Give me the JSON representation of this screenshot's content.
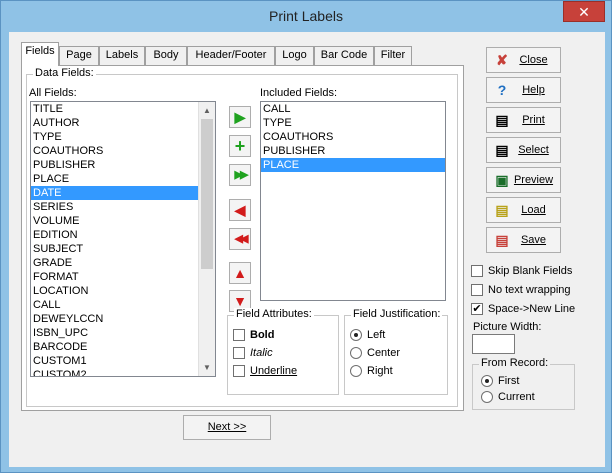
{
  "window": {
    "title": "Print Labels",
    "close_glyph": "✕"
  },
  "tabs": [
    "Fields",
    "Page",
    "Labels",
    "Body",
    "Header/Footer",
    "Logo",
    "Bar Code",
    "Filter"
  ],
  "data_fields_label": "Data Fields:",
  "all_fields": {
    "label": "All Fields:",
    "items": [
      "TITLE",
      "AUTHOR",
      "TYPE",
      "COAUTHORS",
      "PUBLISHER",
      "PLACE",
      "DATE",
      "SERIES",
      "VOLUME",
      "EDITION",
      "SUBJECT",
      "GRADE",
      "FORMAT",
      "LOCATION",
      "CALL",
      "DEWEYLCCN",
      "ISBN_UPC",
      "BARCODE",
      "CUSTOM1",
      "CUSTOM2"
    ],
    "selected": "DATE"
  },
  "included_fields": {
    "label": "Included Fields:",
    "items": [
      "CALL",
      "TYPE",
      "COAUTHORS",
      "PUBLISHER",
      "PLACE"
    ],
    "selected": "PLACE"
  },
  "arrow_buttons": {
    "add": "▶",
    "add_all": "+",
    "add_fast": "▶▶",
    "remove": "◀",
    "remove_all": "◀◀",
    "move_up": "▲",
    "move_down": "▼"
  },
  "field_attributes": {
    "label": "Field Attributes:",
    "bold": "Bold",
    "italic": "Italic",
    "underline": "Underline"
  },
  "field_justification": {
    "label": "Field Justification:",
    "options": [
      "Left",
      "Center",
      "Right"
    ],
    "selected": "Left"
  },
  "side_buttons": {
    "close": "Close",
    "help": "Help",
    "print": "Print",
    "select": "Select",
    "preview": "Preview",
    "load": "Load",
    "save": "Save"
  },
  "side_icons": {
    "close": "✘",
    "help": "?",
    "print": "▤",
    "select": "▤",
    "preview": "▣",
    "load": "▤",
    "save": "▤"
  },
  "options": {
    "skip_blank": {
      "label": "Skip Blank Fields",
      "checked": false
    },
    "no_wrap": {
      "label": "No text wrapping",
      "checked": false
    },
    "space_newline": {
      "label": "Space->New Line",
      "checked": true
    }
  },
  "picture_width": {
    "label": "Picture Width:",
    "value": ""
  },
  "from_record": {
    "label": "From Record:",
    "options": [
      "First",
      "Current"
    ],
    "selected": "First"
  },
  "next_button": "Next >>",
  "colors": {
    "selection": "#3399ff",
    "close_red": "#c7413a",
    "green": "#1fa21f",
    "red": "#d21b1b"
  }
}
